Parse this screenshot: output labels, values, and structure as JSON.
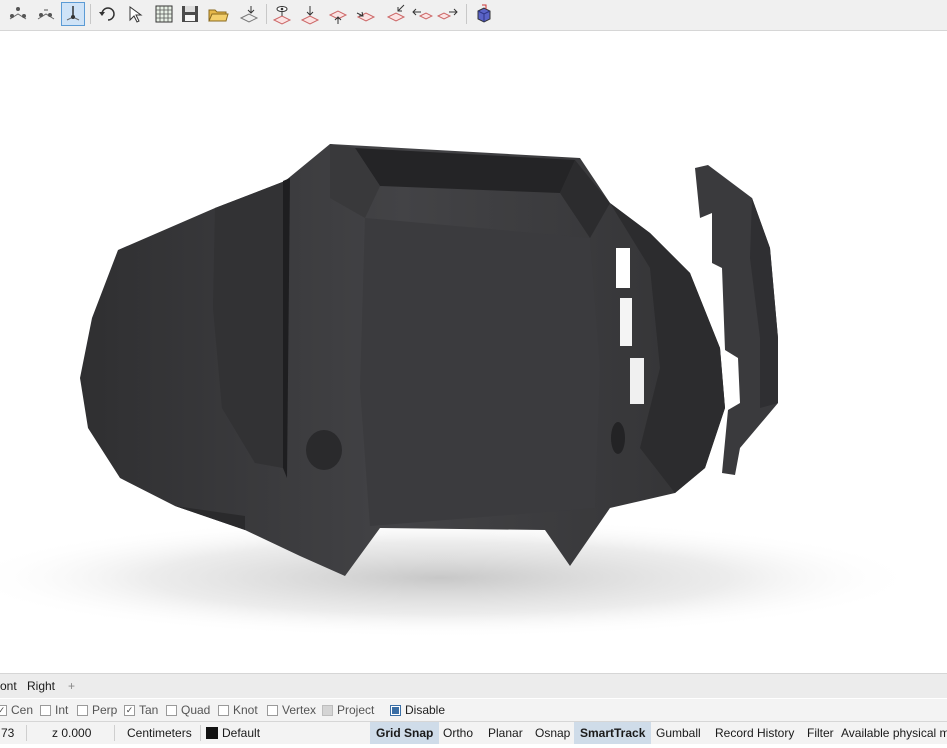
{
  "toolbar": {
    "buttons": [
      {
        "icon": "set-view-cplane-icon"
      },
      {
        "icon": "set-cplane-origin-icon"
      },
      {
        "icon": "set-cplane-z-axis-icon"
      },
      {
        "icon": "undo-view-change-icon"
      },
      {
        "icon": "select-objects-icon"
      },
      {
        "icon": "grid-icon"
      },
      {
        "icon": "save-icon"
      },
      {
        "icon": "open-icon"
      },
      {
        "icon": "import-icon"
      },
      {
        "icon": "view-perspective-icon"
      },
      {
        "icon": "view-top-icon"
      },
      {
        "icon": "view-front-icon"
      },
      {
        "icon": "view-right-icon"
      },
      {
        "icon": "view-back-icon"
      },
      {
        "icon": "view-left-icon"
      },
      {
        "icon": "view-bottom-icon"
      },
      {
        "icon": "render-icon"
      }
    ]
  },
  "viewport_tabs": {
    "items": [
      "ont",
      "Right"
    ],
    "add_icon": "+"
  },
  "osnap": {
    "items": [
      {
        "label": "Cen",
        "checked": true
      },
      {
        "label": "Int",
        "checked": false
      },
      {
        "label": "Perp",
        "checked": false
      },
      {
        "label": "Tan",
        "checked": true
      },
      {
        "label": "Quad",
        "checked": false
      },
      {
        "label": "Knot",
        "checked": false
      },
      {
        "label": "Vertex",
        "checked": false
      },
      {
        "label": "Project",
        "checked": false
      }
    ],
    "disable": {
      "label": "Disable",
      "checked": true
    }
  },
  "status": {
    "coord_partial": "73",
    "z": "z 0.000",
    "units": "Centimeters",
    "layer": "Default",
    "layer_color": "#111111",
    "panes": [
      {
        "label": "Grid Snap",
        "active": true
      },
      {
        "label": "Ortho",
        "active": false
      },
      {
        "label": "Planar",
        "active": false
      },
      {
        "label": "Osnap",
        "active": false
      },
      {
        "label": "SmartTrack",
        "active": true
      },
      {
        "label": "Gumball",
        "active": false
      },
      {
        "label": "Record History",
        "active": false
      },
      {
        "label": "Filter",
        "active": false
      }
    ],
    "message": "Available physical m"
  },
  "colors": {
    "model": "#3f3f42",
    "accent": "#5b9bd5"
  }
}
